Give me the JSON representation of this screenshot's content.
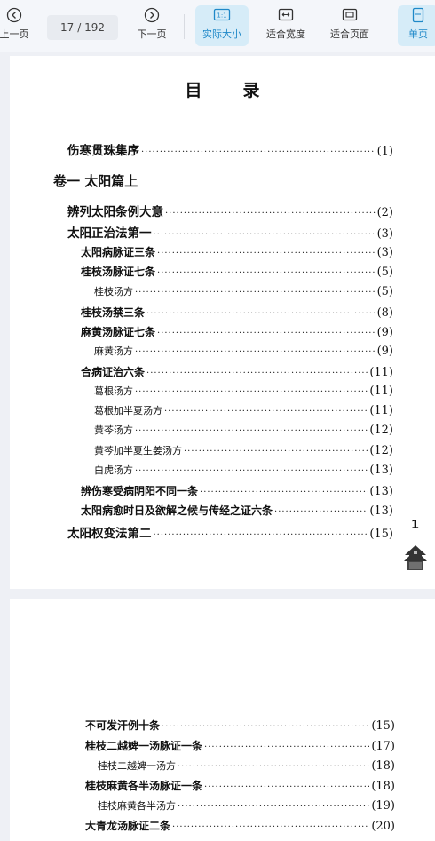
{
  "toolbar": {
    "prev_label": "上一页",
    "next_label": "下一页",
    "current_page": "17",
    "total_pages": "/ 192",
    "actual_size_label": "实际大小",
    "actual_size_icon_text": "1:1",
    "fit_width_label": "适合宽度",
    "fit_page_label": "适合页面",
    "single_page_label": "单页",
    "accent_color": "#1e88c8"
  },
  "page1": {
    "title": "目录",
    "volume_heading": "卷一  太阳篇上",
    "side_page_number": "1",
    "entries": [
      {
        "text": "伤寒贯珠集序",
        "page": "(1)",
        "level": 0
      },
      {
        "text": "辨列太阳条例大意",
        "page": "(2)",
        "level": 0
      },
      {
        "text": "太阳正治法第一",
        "page": "(3)",
        "level": 0
      },
      {
        "text": "太阳病脉证三条",
        "page": "(3)",
        "level": 1
      },
      {
        "text": "桂枝汤脉证七条",
        "page": "(5)",
        "level": 1
      },
      {
        "text": "桂枝汤方",
        "page": "(5)",
        "level": 2
      },
      {
        "text": "桂枝汤禁三条",
        "page": "(8)",
        "level": 1
      },
      {
        "text": "麻黄汤脉证七条",
        "page": "(9)",
        "level": 1
      },
      {
        "text": "麻黄汤方",
        "page": "(9)",
        "level": 2
      },
      {
        "text": "合病证治六条",
        "page": "(11)",
        "level": 1
      },
      {
        "text": "葛根汤方",
        "page": "(11)",
        "level": 2
      },
      {
        "text": "葛根加半夏汤方",
        "page": "(11)",
        "level": 2
      },
      {
        "text": "黄芩汤方",
        "page": "(12)",
        "level": 2
      },
      {
        "text": "黄芩加半夏生姜汤方",
        "page": "(12)",
        "level": 2
      },
      {
        "text": "白虎汤方",
        "page": "(13)",
        "level": 2
      },
      {
        "text": "辨伤寒受病阴阳不同一条",
        "page": "(13)",
        "level": 1
      },
      {
        "text": "太阳病愈时日及欲解之候与传经之证六条",
        "page": "(13)",
        "level": 1
      },
      {
        "text": "太阳权变法第二",
        "page": "(15)",
        "level": 0
      }
    ]
  },
  "page2": {
    "entries": [
      {
        "text": "不可发汗例十条",
        "page": "(15)",
        "level": 1
      },
      {
        "text": "桂枝二越婢一汤脉证一条",
        "page": "(17)",
        "level": 1
      },
      {
        "text": "桂枝二越婢一汤方",
        "page": "(18)",
        "level": 2
      },
      {
        "text": "桂枝麻黄各半汤脉证一条",
        "page": "(18)",
        "level": 1
      },
      {
        "text": "桂枝麻黄各半汤方",
        "page": "(19)",
        "level": 2
      },
      {
        "text": "大青龙汤脉证二条",
        "page": "(20)",
        "level": 1
      }
    ]
  }
}
